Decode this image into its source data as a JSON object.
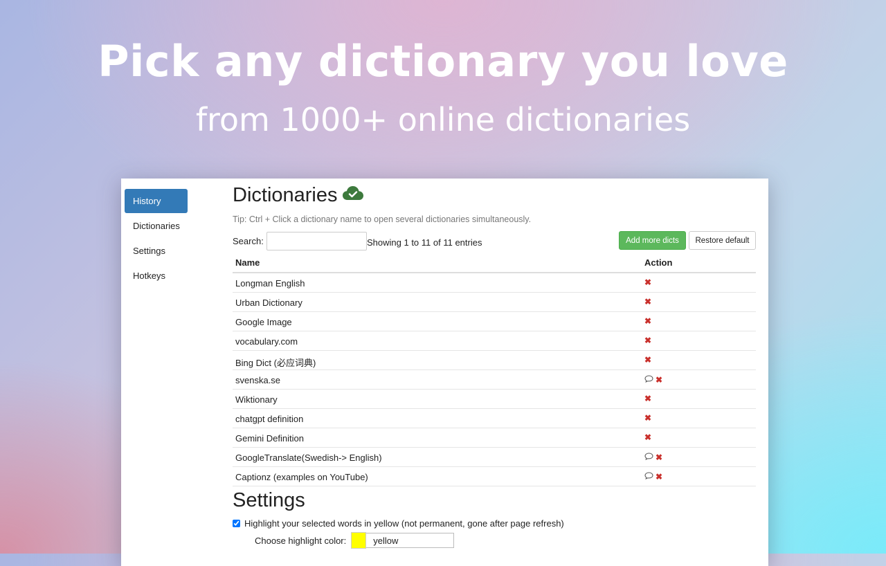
{
  "hero": {
    "title": "Pick any dictionary you love",
    "subtitle": "from 1000+ online dictionaries"
  },
  "sidebar": {
    "items": [
      {
        "label": "History",
        "active": true
      },
      {
        "label": "Dictionaries",
        "active": false
      },
      {
        "label": "Settings",
        "active": false
      },
      {
        "label": "Hotkeys",
        "active": false
      }
    ]
  },
  "dictionaries": {
    "title": "Dictionaries",
    "tip": "Tip: Ctrl + Click a dictionary name to open several dictionaries simultaneously.",
    "search_label": "Search:",
    "search_value": "",
    "entries_info": "Showing 1 to 11 of 11 entries",
    "add_button": "Add more dicts",
    "restore_button": "Restore default",
    "columns": {
      "name": "Name",
      "action": "Action"
    },
    "rows": [
      {
        "name": "Longman English",
        "has_comment": false
      },
      {
        "name": "Urban Dictionary",
        "has_comment": false
      },
      {
        "name": "Google Image",
        "has_comment": false
      },
      {
        "name": "vocabulary.com",
        "has_comment": false
      },
      {
        "name": "Bing Dict (必应词典)",
        "has_comment": false
      },
      {
        "name": "svenska.se",
        "has_comment": true
      },
      {
        "name": "Wiktionary",
        "has_comment": false
      },
      {
        "name": "chatgpt definition",
        "has_comment": false
      },
      {
        "name": "Gemini Definition",
        "has_comment": false
      },
      {
        "name": "GoogleTranslate(Swedish-> English)",
        "has_comment": true
      },
      {
        "name": "Captionz (examples on YouTube)",
        "has_comment": true
      }
    ]
  },
  "settings": {
    "title": "Settings",
    "highlight_label": "Highlight your selected words in yellow (not permanent, gone after page refresh)",
    "highlight_checked": true,
    "color_label": "Choose highlight color:",
    "color_value": "yellow"
  },
  "colors": {
    "accent": "#337ab7",
    "success": "#5cb85c",
    "danger": "#c9302c",
    "highlight": "#ffff00"
  }
}
